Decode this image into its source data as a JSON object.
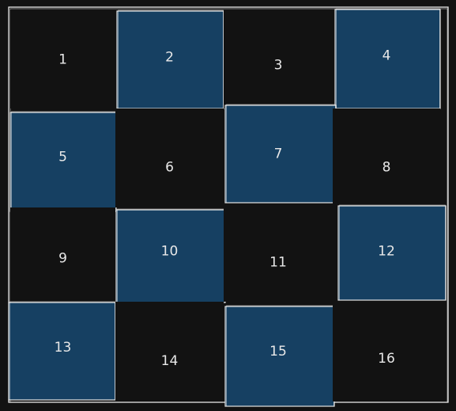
{
  "colors": {
    "background": "#121212",
    "dark_cell": "#121212",
    "blue_cell": "#164062",
    "stroke": "#e6e6e6"
  },
  "grid": {
    "rows": 4,
    "cols": 4,
    "cells": [
      {
        "label": "1",
        "style": "dark"
      },
      {
        "label": "2",
        "style": "blue"
      },
      {
        "label": "3",
        "style": "dark"
      },
      {
        "label": "4",
        "style": "blue"
      },
      {
        "label": "5",
        "style": "blue"
      },
      {
        "label": "6",
        "style": "dark"
      },
      {
        "label": "7",
        "style": "blue"
      },
      {
        "label": "8",
        "style": "dark"
      },
      {
        "label": "9",
        "style": "dark"
      },
      {
        "label": "10",
        "style": "blue"
      },
      {
        "label": "11",
        "style": "dark"
      },
      {
        "label": "12",
        "style": "blue"
      },
      {
        "label": "13",
        "style": "blue"
      },
      {
        "label": "14",
        "style": "dark"
      },
      {
        "label": "15",
        "style": "blue"
      },
      {
        "label": "16",
        "style": "dark"
      }
    ]
  }
}
